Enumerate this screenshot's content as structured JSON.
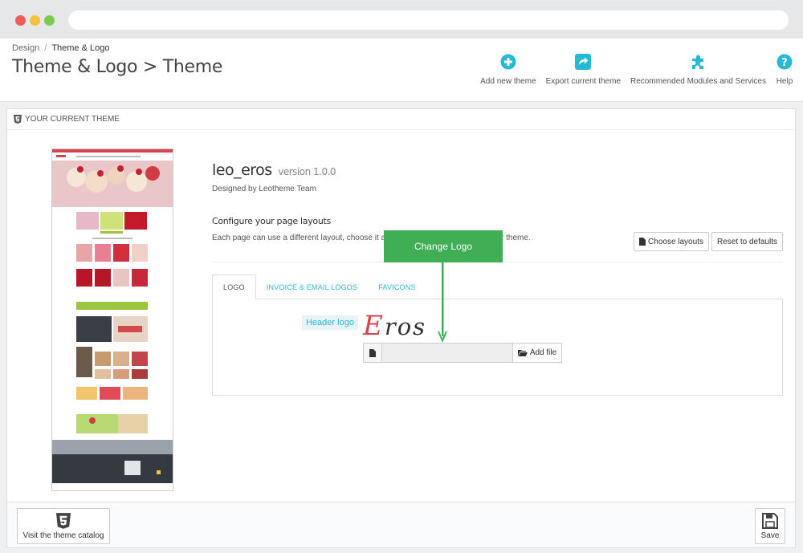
{
  "breadcrumb": {
    "parent": "Design",
    "separator": "/",
    "current": "Theme & Logo"
  },
  "page_title": "Theme & Logo > Theme",
  "toolbar": [
    {
      "label": "Add new theme",
      "icon": "plus-circle-icon",
      "color": "#25b9d7"
    },
    {
      "label": "Export current theme",
      "icon": "share-icon",
      "color": "#25b9d7"
    },
    {
      "label": "Recommended Modules and Services",
      "icon": "puzzle-icon",
      "color": "#25b9d7"
    },
    {
      "label": "Help",
      "icon": "question-circle-icon",
      "color": "#25b9d7"
    }
  ],
  "panel": {
    "heading": "YOUR CURRENT THEME",
    "theme_name": "leo_eros",
    "theme_version": "version 1.0.0",
    "designed_by": "Designed by Leotheme Team",
    "config_title": "Configure your page layouts",
    "config_desc": "Each page can use a different layout, choose it a",
    "config_desc_tail": "r theme.",
    "choose_layouts": "Choose layouts",
    "reset_defaults": "Reset to defaults",
    "tabs": [
      "LOGO",
      "INVOICE & EMAIL LOGOS",
      "FAVICONS"
    ],
    "active_tab": 0,
    "header_logo_label": "Header logo",
    "logo_text_cap": "E",
    "logo_text_rest": "ros",
    "add_file": "Add file"
  },
  "callout": {
    "label": "Change Logo",
    "color": "#3fae54"
  },
  "footer": {
    "catalog": "Visit the theme catalog",
    "save": "Save"
  },
  "colors": {
    "accent": "#25b9d7",
    "callout": "#3fae54",
    "logo_red": "#d9434d"
  }
}
